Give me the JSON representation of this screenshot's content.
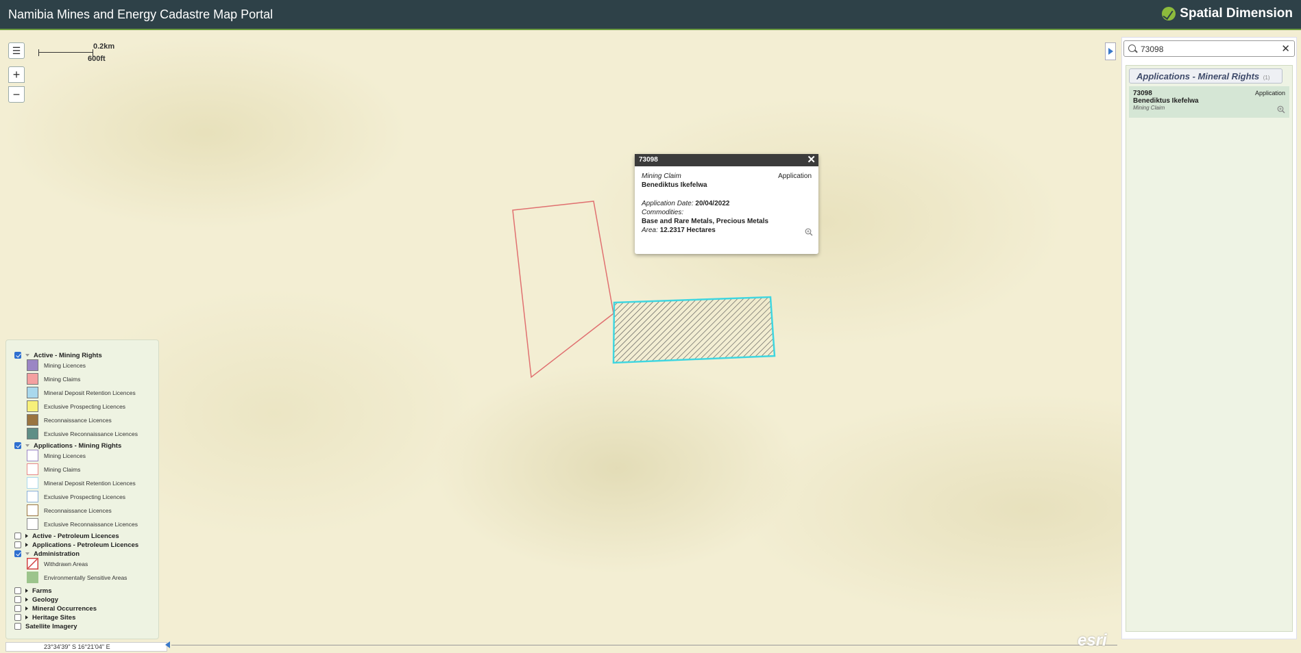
{
  "header": {
    "title": "Namibia Mines and Energy Cadastre Map Portal",
    "brand": "Spatial Dimension"
  },
  "map_controls": {
    "menu_icon": "hamburger-icon",
    "zoom_in": "+",
    "zoom_out": "−"
  },
  "scalebar": {
    "km": "0.2km",
    "ft": "600ft"
  },
  "popup": {
    "id": "73098",
    "type": "Mining Claim",
    "status": "Application",
    "holder": "Benediktus Ikefelwa",
    "app_date_label": "Application Date:",
    "app_date_value": "20/04/2022",
    "commodities_label": "Commodities:",
    "commodities_value": "Base and Rare Metals, Precious Metals",
    "area_label": "Area:",
    "area_value": "12.2317 Hectares"
  },
  "search": {
    "value": "73098",
    "placeholder": ""
  },
  "results": {
    "header": "Applications - Mineral Rights",
    "count": "(1)",
    "items": [
      {
        "id": "73098",
        "status": "Application",
        "holder": "Benediktus Ikefelwa",
        "type": "Mining Claim"
      }
    ]
  },
  "legend": {
    "groups": [
      {
        "label": "Active - Mining Rights",
        "checked": true,
        "expanded": true,
        "items": [
          {
            "label": "Mining Licences",
            "color": "#9b86c4"
          },
          {
            "label": "Mining Claims",
            "color": "#f4a0a0"
          },
          {
            "label": "Mineral Deposit Retention Licences",
            "color": "#a9d8ec"
          },
          {
            "label": "Exclusive Prospecting Licences",
            "color": "#f7f07a"
          },
          {
            "label": "Reconnaissance Licences",
            "color": "#9a7440"
          },
          {
            "label": "Exclusive Reconnaissance Licences",
            "color": "#5f8e86"
          }
        ]
      },
      {
        "label": "Applications - Mining Rights",
        "checked": true,
        "expanded": true,
        "items": [
          {
            "label": "Mining Licences",
            "color": "#9b86c4"
          },
          {
            "label": "Mining Claims",
            "color": "#e88888"
          },
          {
            "label": "Mineral Deposit Retention Licences",
            "color": "#a9d8ec"
          },
          {
            "label": "Exclusive Prospecting Licences",
            "color": "#8ab0d8"
          },
          {
            "label": "Reconnaissance Licences",
            "color": "#9a7440"
          },
          {
            "label": "Exclusive Reconnaissance Licences",
            "color": "#888888"
          }
        ]
      },
      {
        "label": "Active - Petroleum Licences",
        "checked": false,
        "expanded": false
      },
      {
        "label": "Applications - Petroleum Licences",
        "checked": false,
        "expanded": false
      },
      {
        "label": "Administration",
        "checked": true,
        "expanded": true,
        "items": [
          {
            "label": "Withdrawn Areas",
            "color": "#d04040"
          },
          {
            "label": "Environmentally Sensitive Areas",
            "color": "#9cc48c"
          }
        ]
      },
      {
        "label": "Farms",
        "checked": false,
        "expanded": false
      },
      {
        "label": "Geology",
        "checked": false,
        "expanded": false
      },
      {
        "label": "Mineral Occurrences",
        "checked": false,
        "expanded": false
      },
      {
        "label": "Heritage Sites",
        "checked": false,
        "expanded": false
      },
      {
        "label": "Satellite Imagery",
        "checked": false,
        "expanded": false
      }
    ]
  },
  "coordinates": "23°34'39\" S  16°21'04\" E",
  "attribution": "esri",
  "colors": {
    "topbar": "#2e4148",
    "claim_outline": "#e07070",
    "selected_outline": "#3fd6e0",
    "accent": "#3a79c9"
  }
}
